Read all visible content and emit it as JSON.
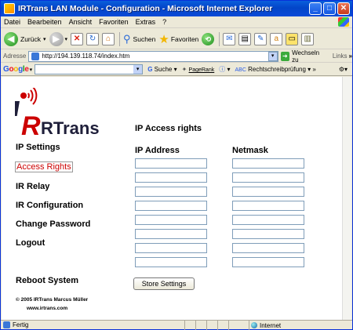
{
  "window": {
    "title": "IRTrans LAN Module - Configuration - Microsoft Internet Explorer"
  },
  "menu": [
    "Datei",
    "Bearbeiten",
    "Ansicht",
    "Favoriten",
    "Extras",
    "?"
  ],
  "toolbar": {
    "back": "Zurück",
    "search": "Suchen",
    "favorites": "Favoriten"
  },
  "address": {
    "label": "Adresse",
    "url": "http://194.139.118.74/index.htm",
    "go": "Wechseln zu",
    "links": "Links"
  },
  "googlebar": {
    "brand": "Google",
    "search": "Suche",
    "pagerank": "PageRank",
    "spell": "Rechtschreibprüfung"
  },
  "page": {
    "logo_text": "RTrans",
    "title": "IP Access rights",
    "nav": [
      "IP Settings",
      "Access Rights",
      "IR Relay",
      "IR Configuration",
      "Change Password",
      "Logout"
    ],
    "reboot": "Reboot System",
    "col_ip": "IP Address",
    "col_netmask": "Netmask",
    "rows": 8,
    "store_button": "Store Settings",
    "copyright": "© 2005 IRTrans Marcus Müller",
    "website": "www.irtrans.com"
  },
  "status": {
    "text": "Fertig",
    "zone": "Internet"
  },
  "colors": {
    "titlebar": "#0a5fdc",
    "active_link": "#cc0000",
    "logo_red": "#cc0000",
    "logo_dark": "#1f1f3a"
  }
}
